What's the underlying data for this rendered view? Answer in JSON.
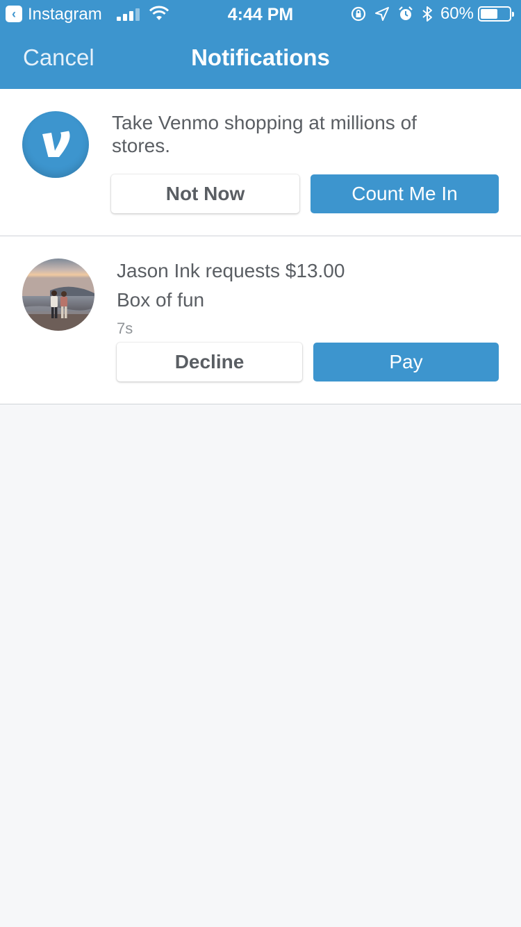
{
  "status_bar": {
    "back_app": "Instagram",
    "time": "4:44 PM",
    "battery_percent": "60%",
    "battery_level": 0.6,
    "signal_bars": 4,
    "signal_active": 3
  },
  "nav": {
    "cancel_label": "Cancel",
    "title": "Notifications"
  },
  "promo": {
    "text": "Take Venmo shopping at millions of stores.",
    "dismiss_label": "Not Now",
    "accept_label": "Count Me In",
    "logo_icon": "venmo-logo-icon"
  },
  "request": {
    "title": "Jason Ink requests $13.00",
    "note": "Box of fun",
    "time_ago": "7s",
    "decline_label": "Decline",
    "pay_label": "Pay"
  },
  "colors": {
    "brand_blue": "#3d95ce",
    "text_gray": "#5a5e63",
    "background": "#f6f7f9"
  }
}
